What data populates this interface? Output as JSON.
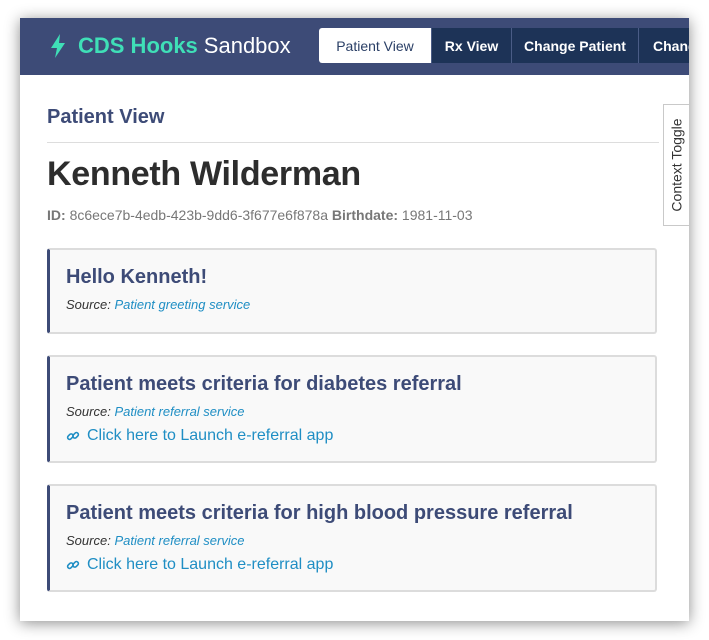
{
  "app": {
    "brand_name": "CDS Hooks",
    "brand_suffix": "Sandbox",
    "brand_color": "#3fdfb7",
    "header_color": "#3d4b77",
    "nav": [
      "Patient View",
      "Rx View",
      "Change Patient",
      "Chang"
    ]
  },
  "context_toggle": "Context Toggle",
  "page": {
    "section_title": "Patient View",
    "patient_name": "Kenneth Wilderman",
    "id_label": "ID:",
    "id_value": "8c6ece7b-4edb-423b-9dd6-3f677e6f878a",
    "birthdate_label": "Birthdate:",
    "birthdate_value": "1981-11-03"
  },
  "cards": [
    {
      "title": "Hello Kenneth!",
      "source_label": "Source:",
      "source": "Patient greeting service",
      "link": ""
    },
    {
      "title": "Patient meets criteria for diabetes referral",
      "source_label": "Source:",
      "source": "Patient referral service",
      "link": "Click here to Launch e-referral app",
      "link_icon": "link-icon"
    },
    {
      "title": "Patient meets criteria for high blood pressure referral",
      "source_label": "Source:",
      "source": "Patient referral service",
      "link": "Click here to Launch e-referral app",
      "link_icon": "link-icon"
    }
  ]
}
